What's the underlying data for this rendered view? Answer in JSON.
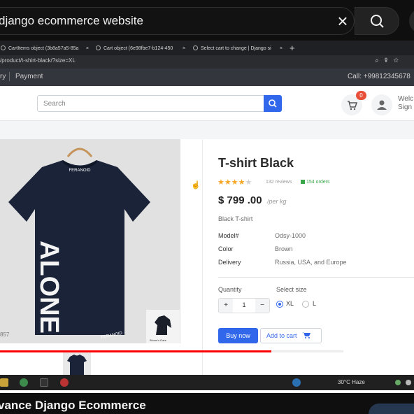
{
  "youtube": {
    "search_query": "django ecommerce website",
    "video_title": "vance Django Ecommerce",
    "progress_fraction": 0.655,
    "buffered_fraction": 0.83
  },
  "browser": {
    "tabs": [
      {
        "label": "CartItems object (3b8a57a5-85a"
      },
      {
        "label": "Cart object (6e98fbe7-b124-450"
      },
      {
        "label": "Select cart to change | Django si"
      }
    ],
    "new_tab": "+",
    "url": "/product/t-shirt-black/?size=XL"
  },
  "site": {
    "nav": {
      "item1": "ry",
      "item2": "Payment"
    },
    "phone": "Call: +99812345678",
    "search_placeholder": "Search",
    "cart_count": "0",
    "welcome_line1": "Welc",
    "welcome_line2": "Sign"
  },
  "product": {
    "title": "T-shirt Black",
    "rating": 4,
    "reviews": "132 reviews",
    "orders": "154 orders",
    "price": "$ 799 .00",
    "per_unit": "/per kg",
    "description": "Black T-shirt",
    "specs": [
      {
        "key": "Model#",
        "value": "Odsy-1000"
      },
      {
        "key": "Color",
        "value": "Brown"
      },
      {
        "key": "Delivery",
        "value": "Russia, USA, and Europe"
      }
    ],
    "quantity_label": "Quantity",
    "quantity": "1",
    "size_label": "Select size",
    "sizes": [
      {
        "label": "XL",
        "selected": true
      },
      {
        "label": "L",
        "selected": false
      }
    ],
    "buy_now": "Buy now",
    "add_to_cart": "Add to cart",
    "image_code": "857",
    "shirt_word": "ALONE",
    "shirt_brand": "FERANOID",
    "brand_caption": "Bloom's Dare"
  },
  "taskbar": {
    "weather": "30°C  Haze"
  },
  "colors": {
    "accent": "#3167eb",
    "badge": "#e8503a",
    "star": "#f5a623",
    "green": "#39a74a",
    "progress": "#ff0000"
  }
}
